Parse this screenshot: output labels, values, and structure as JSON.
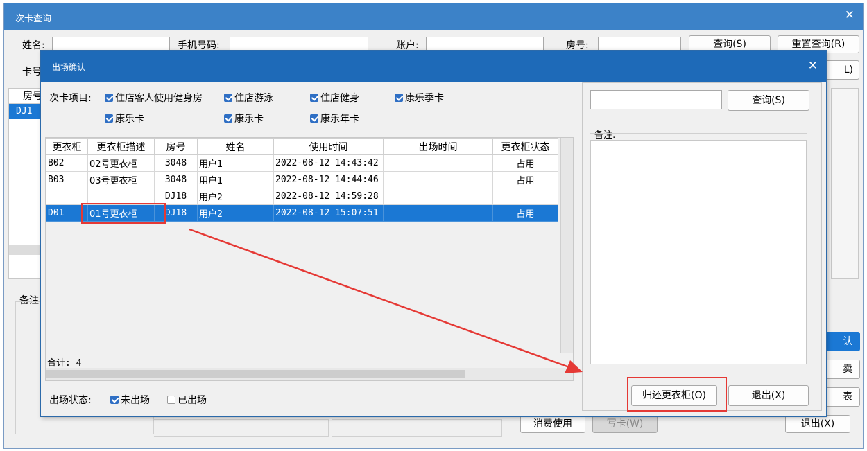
{
  "outer": {
    "title": "次卡查询",
    "fields": {
      "name_label": "姓名:",
      "phone_label": "手机号码:",
      "account_label": "账户:",
      "room_label": "房号:",
      "card_label": "卡号"
    },
    "buttons": {
      "search": "查询(S)",
      "reset": "重置查询(R)",
      "hidden_btn_suffix": "L)",
      "confirm_partial": "认",
      "sell_partial": "卖",
      "report_partial": "表",
      "consume": "消费使用",
      "write_card": "写卡(W)",
      "exit": "退出(X)"
    },
    "left_list": {
      "header": "房号",
      "row": "DJ1"
    },
    "memo_label": "备注"
  },
  "dialog": {
    "title": "出场确认",
    "items_label": "次卡项目:",
    "items": [
      {
        "label": "住店客人使用健身房",
        "checked": true
      },
      {
        "label": "住店游泳",
        "checked": true
      },
      {
        "label": "住店健身",
        "checked": true
      },
      {
        "label": "康乐季卡",
        "checked": true
      },
      {
        "label": "康乐卡",
        "checked": true
      },
      {
        "label": "康乐卡",
        "checked": true
      },
      {
        "label": "康乐年卡",
        "checked": true
      }
    ],
    "table": {
      "columns": [
        "更衣柜",
        "更衣柜描述",
        "房号",
        "姓名",
        "使用时间",
        "出场时间",
        "更衣柜状态"
      ],
      "rows": [
        {
          "locker": "B02",
          "desc": "02号更衣柜",
          "room": "3048",
          "name": "用户1",
          "used": "2022-08-12 14:43:42",
          "out": "",
          "status": "占用"
        },
        {
          "locker": "B03",
          "desc": "03号更衣柜",
          "room": "3048",
          "name": "用户1",
          "used": "2022-08-12 14:44:46",
          "out": "",
          "status": "占用"
        },
        {
          "locker": "",
          "desc": "",
          "room": "DJ18",
          "name": "用户2",
          "used": "2022-08-12 14:59:28",
          "out": "",
          "status": ""
        },
        {
          "locker": "D01",
          "desc": "01号更衣柜",
          "room": "DJ18",
          "name": "用户2",
          "used": "2022-08-12 15:07:51",
          "out": "",
          "status": "占用",
          "selected": true
        }
      ],
      "total": "合计: 4"
    },
    "status_label": "出场状态:",
    "status_not_out": "未出场",
    "status_out": "已出场",
    "search_btn": "查询(S)",
    "memo_label": "备注:",
    "return_btn": "归还更衣柜(O)",
    "exit_btn": "退出(X)"
  },
  "annotation_color": "#e53935"
}
